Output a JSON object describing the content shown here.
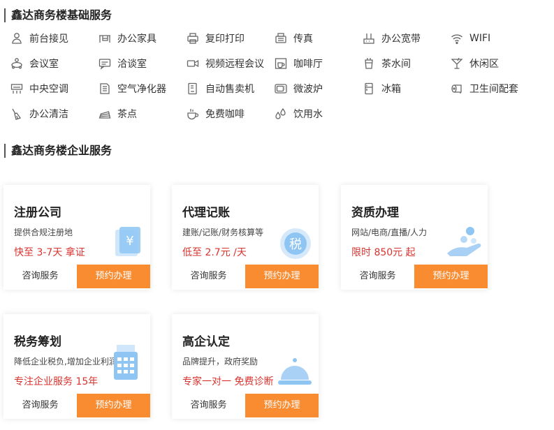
{
  "basic": {
    "title": "鑫达商务楼基础服务",
    "items": [
      {
        "label": "前台接见",
        "icon": "person-icon"
      },
      {
        "label": "办公家具",
        "icon": "desk-icon"
      },
      {
        "label": "复印打印",
        "icon": "printer-icon"
      },
      {
        "label": "传真",
        "icon": "fax-icon"
      },
      {
        "label": "办公宽带",
        "icon": "network-icon"
      },
      {
        "label": "WIFI",
        "icon": "wifi-icon"
      },
      {
        "label": "会议室",
        "icon": "meeting-icon"
      },
      {
        "label": "洽谈室",
        "icon": "chat-icon"
      },
      {
        "label": "视频远程会议",
        "icon": "video-icon"
      },
      {
        "label": "咖啡厅",
        "icon": "coffee-shop-icon"
      },
      {
        "label": "茶水间",
        "icon": "tea-icon"
      },
      {
        "label": "休闲区",
        "icon": "cocktail-icon"
      },
      {
        "label": "中央空调",
        "icon": "air-conditioner-icon"
      },
      {
        "label": "空气净化器",
        "icon": "air-purifier-icon"
      },
      {
        "label": "自动售卖机",
        "icon": "vending-machine-icon"
      },
      {
        "label": "微波炉",
        "icon": "microwave-icon"
      },
      {
        "label": "冰箱",
        "icon": "fridge-icon"
      },
      {
        "label": "卫生间配套",
        "icon": "toilet-paper-icon"
      },
      {
        "label": "办公清洁",
        "icon": "cleaning-icon"
      },
      {
        "label": "茶点",
        "icon": "cake-icon"
      },
      {
        "label": "免费咖啡",
        "icon": "coffee-cup-icon"
      },
      {
        "label": "饮用水",
        "icon": "water-drop-icon"
      }
    ]
  },
  "enterprise": {
    "title": "鑫达商务楼企业服务",
    "consult_label": "咨询服务",
    "book_label": "预约办理",
    "cards": [
      {
        "title": "注册公司",
        "desc": "提供合规注册地",
        "promo": "快至 3-7天 拿证",
        "icon": "yen-card-icon"
      },
      {
        "title": "代理记账",
        "desc": "建账/记账/财务核算等",
        "promo": "低至 2.7元 /天",
        "icon": "tax-seal-icon"
      },
      {
        "title": "资质办理",
        "desc": "网站/电商/直播/人力",
        "promo": "限时 850元 起",
        "icon": "hand-coins-icon"
      },
      {
        "title": "税务筹划",
        "desc": "降低企业税负,增加企业利润",
        "promo": "专注企业服务 15年",
        "icon": "calculator-icon"
      },
      {
        "title": "高企认定",
        "desc": "品牌提升，政府奖励",
        "promo": "专家一对一 免费诊断",
        "icon": "service-bell-icon"
      }
    ]
  },
  "colors": {
    "accent": "#f98b31",
    "promo": "#d8342f",
    "icon_light": "#6fb3ee"
  }
}
